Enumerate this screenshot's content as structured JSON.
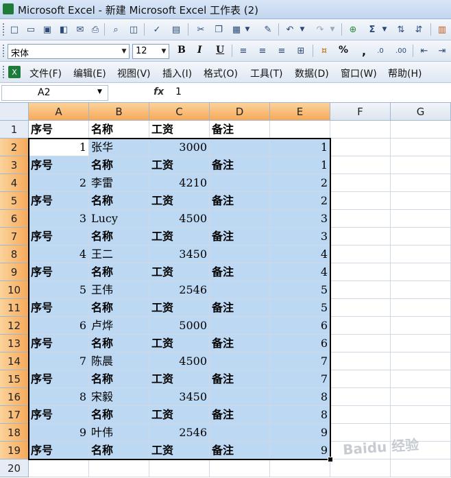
{
  "window": {
    "title": "Microsoft Excel - 新建 Microsoft Excel 工作表 (2)"
  },
  "format_toolbar": {
    "font": "宋体",
    "size": "12",
    "bold": "B",
    "italic": "I",
    "underline": "U",
    "percent": "%",
    "comma": ","
  },
  "menu": {
    "items": [
      "文件(F)",
      "编辑(E)",
      "视图(V)",
      "插入(I)",
      "格式(O)",
      "工具(T)",
      "数据(D)",
      "窗口(W)",
      "帮助(H)"
    ]
  },
  "formula_bar": {
    "name_box": "A2",
    "fx": "fx",
    "value": "1"
  },
  "columns": [
    "A",
    "B",
    "C",
    "D",
    "E",
    "F",
    "G"
  ],
  "rows": [
    {
      "n": "1",
      "a": "序号",
      "b": "名称",
      "c": "工资",
      "d": "备注",
      "e": ""
    },
    {
      "n": "2",
      "a": "1",
      "b": "张华",
      "c": "3000",
      "d": "",
      "e": "1"
    },
    {
      "n": "3",
      "a": "序号",
      "b": "名称",
      "c": "工资",
      "d": "备注",
      "e": "1"
    },
    {
      "n": "4",
      "a": "2",
      "b": "李雷",
      "c": "4210",
      "d": "",
      "e": "2"
    },
    {
      "n": "5",
      "a": "序号",
      "b": "名称",
      "c": "工资",
      "d": "备注",
      "e": "2"
    },
    {
      "n": "6",
      "a": "3",
      "b": "Lucy",
      "c": "4500",
      "d": "",
      "e": "3"
    },
    {
      "n": "7",
      "a": "序号",
      "b": "名称",
      "c": "工资",
      "d": "备注",
      "e": "3"
    },
    {
      "n": "8",
      "a": "4",
      "b": "王二",
      "c": "3450",
      "d": "",
      "e": "4"
    },
    {
      "n": "9",
      "a": "序号",
      "b": "名称",
      "c": "工资",
      "d": "备注",
      "e": "4"
    },
    {
      "n": "10",
      "a": "5",
      "b": "王伟",
      "c": "2546",
      "d": "",
      "e": "5"
    },
    {
      "n": "11",
      "a": "序号",
      "b": "名称",
      "c": "工资",
      "d": "备注",
      "e": "5"
    },
    {
      "n": "12",
      "a": "6",
      "b": "卢烨",
      "c": "5000",
      "d": "",
      "e": "6"
    },
    {
      "n": "13",
      "a": "序号",
      "b": "名称",
      "c": "工资",
      "d": "备注",
      "e": "6"
    },
    {
      "n": "14",
      "a": "7",
      "b": "陈晨",
      "c": "4500",
      "d": "",
      "e": "7"
    },
    {
      "n": "15",
      "a": "序号",
      "b": "名称",
      "c": "工资",
      "d": "备注",
      "e": "7"
    },
    {
      "n": "16",
      "a": "8",
      "b": "宋毅",
      "c": "3450",
      "d": "",
      "e": "8"
    },
    {
      "n": "17",
      "a": "序号",
      "b": "名称",
      "c": "工资",
      "d": "备注",
      "e": "8"
    },
    {
      "n": "18",
      "a": "9",
      "b": "叶伟",
      "c": "2546",
      "d": "",
      "e": "9"
    },
    {
      "n": "19",
      "a": "序号",
      "b": "名称",
      "c": "工资",
      "d": "备注",
      "e": "9"
    },
    {
      "n": "20",
      "a": "",
      "b": "",
      "c": "",
      "d": "",
      "e": ""
    }
  ],
  "watermark": "Baidu 经验",
  "colors": {
    "selection_fill": "#bcd8f3",
    "header_highlight": "#f6a95a",
    "title_bar": "#c2d6ee"
  }
}
